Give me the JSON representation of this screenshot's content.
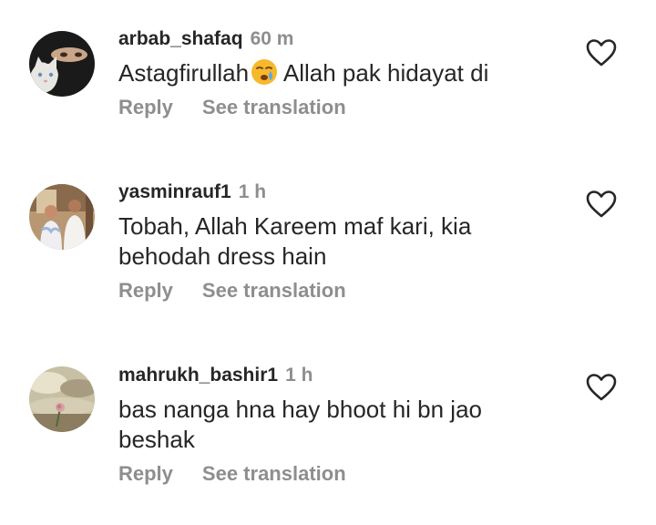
{
  "comments": [
    {
      "username": "arbab_shafaq",
      "time": "60 m",
      "text_before_emoji": "Astagfirullah",
      "emoji": "crying-face-emoji",
      "text_after_emoji": " Allah pak hidayat di",
      "reply_label": "Reply",
      "translate_label": "See translation",
      "avatar": "niqab-woman-with-cat"
    },
    {
      "username": "yasminrauf1",
      "time": "1 h",
      "text": "Tobah, Allah Kareem maf kari, kia\nbehodah dress hain",
      "reply_label": "Reply",
      "translate_label": "See translation",
      "avatar": "two-people-indoor-photo"
    },
    {
      "username": "mahrukh_bashir1",
      "time": "1 h",
      "text": "bas nanga hna hay bhoot hi bn jao\nbeshak",
      "reply_label": "Reply",
      "translate_label": "See translation",
      "avatar": "sky-clouds-with-rose"
    }
  ],
  "icons": {
    "like": "heart-outline-icon"
  },
  "colors": {
    "text": "#262626",
    "secondary": "#8e8e8e",
    "background": "#ffffff"
  }
}
